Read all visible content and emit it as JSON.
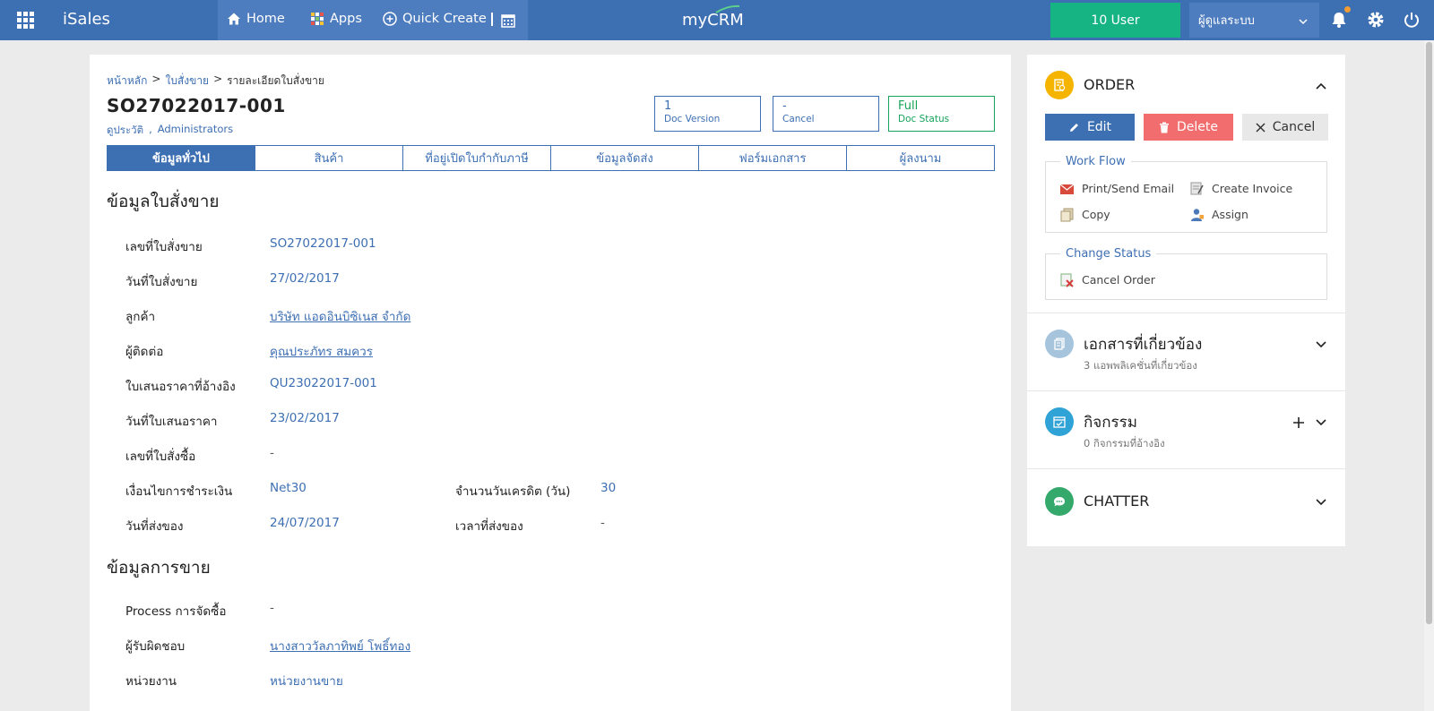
{
  "topbar": {
    "app_name": "iSales",
    "nav": [
      {
        "label": "Home",
        "icon": "home-icon"
      },
      {
        "label": "Apps",
        "icon": "apps-icon"
      },
      {
        "label": "Quick Create",
        "icon": "plus-circle-icon"
      }
    ],
    "brand": "myCRM",
    "user_button": "10 User",
    "role_select": "ผู้ดูแลระบบ",
    "colors": {
      "bar": "#3d6fb3",
      "user_button": "#16b383",
      "notification_dot": "#f39c35"
    }
  },
  "breadcrumb": {
    "items": [
      "หน้าหลัก",
      "ใบสั่งขาย",
      "รายละเอียดใบสั่งขาย"
    ],
    "separator": ">"
  },
  "header": {
    "doc_no": "SO27022017-001",
    "owner_link": "ดูประวัติ",
    "owner_sep": ",",
    "owner_name": "Administrators"
  },
  "stats": [
    {
      "value": "1",
      "label": "Doc Version"
    },
    {
      "value": "-",
      "label": "Cancel"
    },
    {
      "value": "Full",
      "label": "Doc Status"
    }
  ],
  "tabs": [
    "ข้อมูลทั่วไป",
    "สินค้า",
    "ที่อยู่เปิดใบกำกับภาษี",
    "ข้อมูลจัดส่ง",
    "ฟอร์มเอกสาร",
    "ผู้ลงนาม"
  ],
  "active_tab": "ข้อมูลทั่วไป",
  "sales_order_section": {
    "title": "ข้อมูลใบสั่งขาย",
    "fields": [
      {
        "label": "เลขที่ใบสั่งขาย",
        "value": "SO27022017-001"
      },
      {
        "label": "วันที่ใบสั่งขาย",
        "value": "27/02/2017"
      },
      {
        "label": "ลูกค้า",
        "value": "บริษัท แอดอินบิซิเนส จำกัด"
      },
      {
        "label": "ผู้ติดต่อ",
        "value": "คุณประภัทร สมควร"
      },
      {
        "label": "ใบเสนอราคาที่อ้างอิง",
        "value": "QU23022017-001"
      },
      {
        "label": "วันที่ใบเสนอราคา",
        "value": "23/02/2017"
      },
      {
        "label": "เลขที่ใบสั่งซื้อ",
        "value": "-"
      },
      {
        "label": "เงื่อนไขการชำระเงิน",
        "value": "Net30"
      },
      {
        "label": "วันที่ส่งของ",
        "value": "24/07/2017"
      }
    ],
    "extra_fields": [
      {
        "label": "จำนวนวันเครดิต (วัน)",
        "value": "30"
      },
      {
        "label": "เวลาที่ส่งของ",
        "value": "-"
      }
    ]
  },
  "sales_info_section": {
    "title": "ข้อมูลการขาย",
    "fields": [
      {
        "label": "Process การจัดซื้อ",
        "value": "-"
      },
      {
        "label": "ผู้รับผิดชอบ",
        "value": "นางสาววัลภาทิพย์ โพธิ์ทอง"
      },
      {
        "label": "หน่วยงาน",
        "value": "หน่วยงานขาย"
      }
    ]
  },
  "side": {
    "order": {
      "title": "ORDER",
      "buttons": {
        "edit": "Edit",
        "delete": "Delete",
        "cancel": "Cancel"
      },
      "workflow_title": "Work Flow",
      "workflow_items": [
        "Print/Send Email",
        "Create Invoice",
        "Copy",
        "Assign"
      ],
      "change_status_title": "Change Status",
      "change_status_items": [
        "Cancel Order"
      ]
    },
    "related_docs": {
      "title": "เอกสารที่เกี่ยวข้อง",
      "subtitle": "3 แอพพลิเคชั่นที่เกี่ยวข้อง"
    },
    "activities": {
      "title": "กิจกรรม",
      "subtitle": "0 กิจกรรมที่อ้างอิง"
    },
    "chatter": {
      "title": "CHATTER"
    },
    "colors": {
      "order_icon": "#f5b400",
      "edit": "#3d6fb3",
      "delete": "#f26d6d",
      "related_icon": "#a7c4dd",
      "activity_icon": "#2fa3d6",
      "chatter_icon": "#35a86b"
    }
  }
}
